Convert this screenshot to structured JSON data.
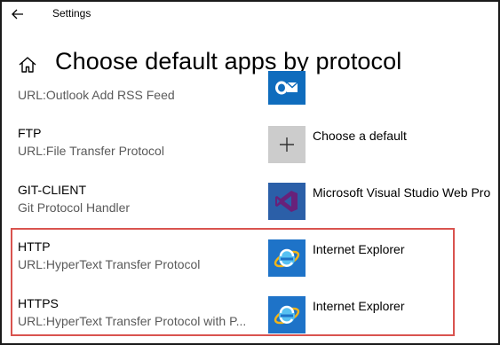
{
  "window": {
    "title": "Settings"
  },
  "page": {
    "title": "Choose default apps by protocol"
  },
  "colors": {
    "outlook": "#0f6cbd",
    "choose_default_tile": "#cccccc",
    "vs_tile": "#68217a",
    "ie_tile": "#1e73c8",
    "highlight_border": "#d9534f"
  },
  "protocols": [
    {
      "name": "",
      "description": "URL:Outlook Add RSS Feed",
      "app": "",
      "icon": "outlook-icon"
    },
    {
      "name": "FTP",
      "description": "URL:File Transfer Protocol",
      "app": "Choose a default",
      "icon": "plus-icon"
    },
    {
      "name": "GIT-CLIENT",
      "description": "Git Protocol Handler",
      "app": "Microsoft Visual Studio Web Pro",
      "icon": "visual-studio-icon"
    },
    {
      "name": "HTTP",
      "description": "URL:HyperText Transfer Protocol",
      "app": "Internet Explorer",
      "icon": "internet-explorer-icon"
    },
    {
      "name": "HTTPS",
      "description": "URL:HyperText Transfer Protocol with P...",
      "app": "Internet Explorer",
      "icon": "internet-explorer-icon"
    }
  ]
}
